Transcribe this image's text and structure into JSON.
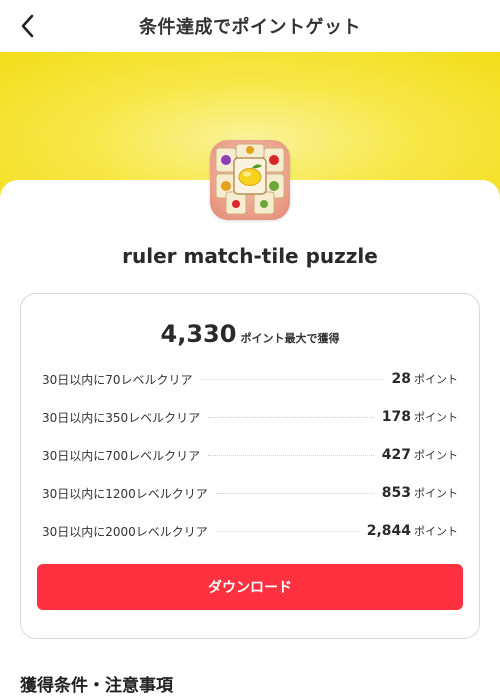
{
  "header": {
    "title": "条件達成でポイントゲット",
    "back_icon": "chevron-left-icon"
  },
  "app": {
    "name": "ruler match-tile puzzle",
    "icon": "fruit-tile-puzzle-app-icon"
  },
  "rewards": {
    "total_points": "4,330",
    "total_label": "ポイント最大で獲得",
    "unit": "ポイント",
    "items": [
      {
        "condition": "30日以内に70レベルクリア",
        "points": "28"
      },
      {
        "condition": "30日以内に350レベルクリア",
        "points": "178"
      },
      {
        "condition": "30日以内に700レベルクリア",
        "points": "427"
      },
      {
        "condition": "30日以内に1200レベルクリア",
        "points": "853"
      },
      {
        "condition": "30日以内に2000レベルクリア",
        "points": "2,844"
      }
    ]
  },
  "download_button": {
    "label": "ダウンロード"
  },
  "section": {
    "heading": "獲得条件・注意事項"
  },
  "colors": {
    "banner": "#f2dd18",
    "accent": "#ff3040"
  }
}
